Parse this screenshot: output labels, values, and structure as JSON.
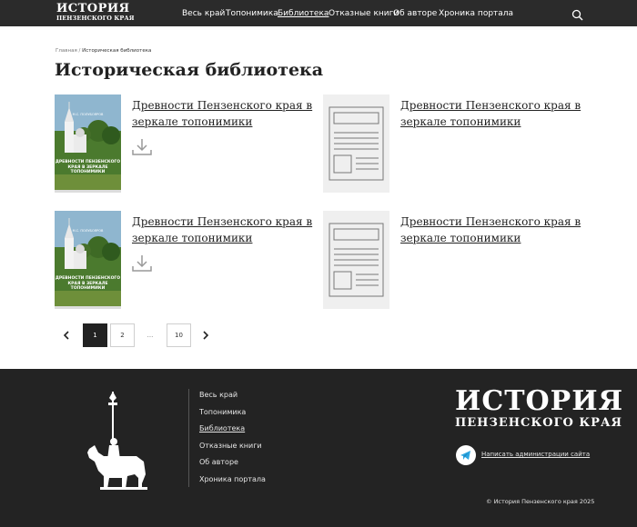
{
  "header": {
    "logo_line1": "ИСТОРИЯ",
    "logo_line2": "ПЕНЗЕНСКОГО КРАЯ",
    "nav": [
      "Весь край",
      "Топонимика",
      "Библиотека",
      "Отказные книги",
      "Об авторе",
      "Хроника портала"
    ],
    "active_nav": "Библиотека",
    "search_icon": "search-icon"
  },
  "breadcrumb": {
    "home": "Главная",
    "separator": "/",
    "current": "Историческая библиотека"
  },
  "page_title": "Историческая библиотека",
  "cards": [
    {
      "title": "Древности Пензенского края в зеркале топонимики",
      "has_cover": true,
      "cover_author": "М.С. ПОЛУБОЯРОВ",
      "cover_title": "ДРЕВНОСТИ ПЕНЗЕНСКОГО КРАЯ В ЗЕРКАЛЕ ТОПОНИМИКИ",
      "download_icon": "download-icon"
    },
    {
      "title": "Древности Пензенского края в зеркале топонимики",
      "has_cover": false
    },
    {
      "title": "Древности Пензенского края в зеркале топонимики",
      "has_cover": true,
      "cover_author": "М.С. ПОЛУБОЯРОВ",
      "cover_title": "ДРЕВНОСТИ ПЕНЗЕНСКОГО КРАЯ В ЗЕРКАЛЕ ТОПОНИМИКИ",
      "download_icon": "download-icon"
    },
    {
      "title": "Древности Пензенского края в зеркале топонимики",
      "has_cover": false
    }
  ],
  "pagination": {
    "pages": [
      "1",
      "2"
    ],
    "ellipsis": "...",
    "last": "10",
    "current": "1"
  },
  "footer": {
    "nav": [
      "Весь край",
      "Топонимика",
      "Библиотека",
      "Отказные книги",
      "Об авторе",
      "Хроника портала"
    ],
    "active_nav": "Библиотека",
    "logo_line1": "ИСТОРИЯ",
    "logo_line2": "ПЕНЗЕНСКОГО КРАЯ",
    "contact_link": "Написать администрации сайта",
    "copyright": "© История Пензенского края 2025"
  },
  "colors": {
    "header_bg": "#2b2b2b",
    "footer_bg": "#232323",
    "active_page": "#222222",
    "telegram": "#2ca5e0"
  }
}
